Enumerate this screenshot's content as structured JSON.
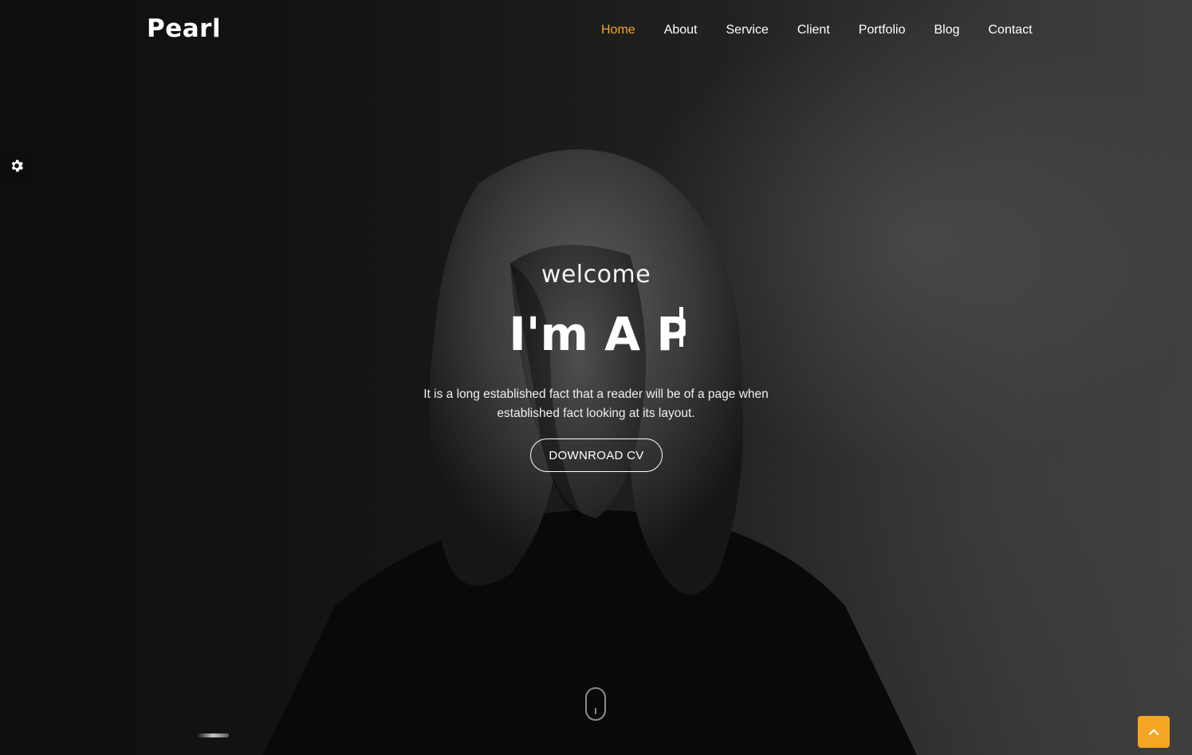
{
  "header": {
    "logo": "Pearl",
    "nav": [
      {
        "label": "Home",
        "active": true
      },
      {
        "label": "About",
        "active": false
      },
      {
        "label": "Service",
        "active": false
      },
      {
        "label": "Client",
        "active": false
      },
      {
        "label": "Portfolio",
        "active": false
      },
      {
        "label": "Blog",
        "active": false
      },
      {
        "label": "Contact",
        "active": false
      }
    ]
  },
  "hero": {
    "greeting": "welcome",
    "typed_text": "I'm A P",
    "description_line1": "It is a long established fact that a reader will be of a page when",
    "description_line2": "established fact looking at its layout.",
    "cta_label": "DOWNROAD CV"
  },
  "widgets": {
    "settings_icon": "gear-icon",
    "scroll_icon": "mouse-scroll-icon",
    "back_to_top_icon": "chevron-up-icon"
  },
  "colors": {
    "accent": "#f5a623",
    "text": "#ffffff",
    "background": "#1a1a1a"
  }
}
